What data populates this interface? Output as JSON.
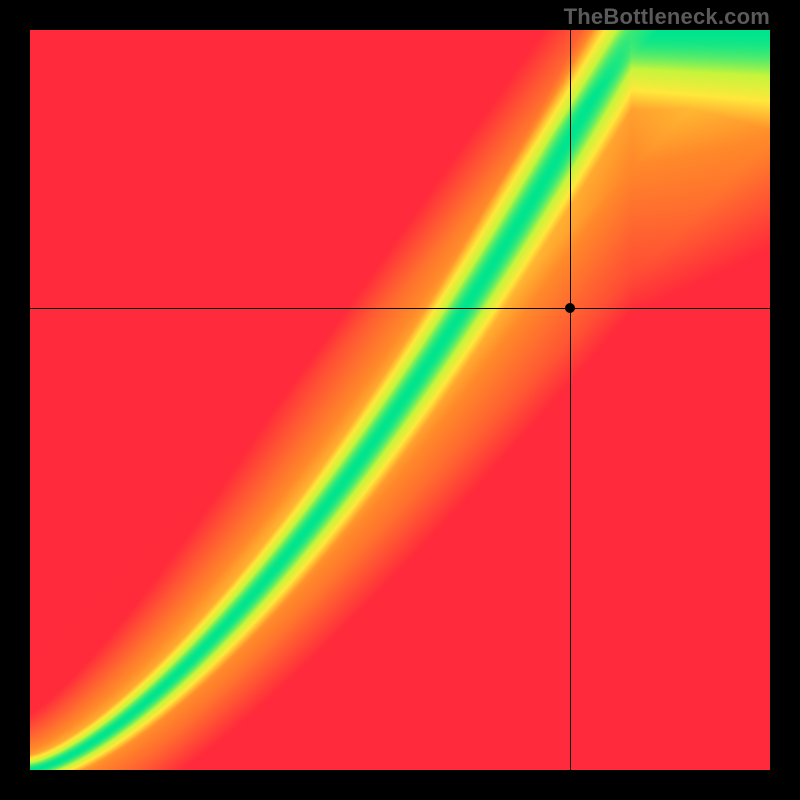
{
  "watermark": "TheBottleneck.com",
  "chart_data": {
    "type": "heatmap",
    "title": "",
    "xlabel": "",
    "ylabel": "",
    "xlim": [
      0,
      100
    ],
    "ylim": [
      0,
      100
    ],
    "grid": false,
    "bands": [
      {
        "function": "6*(x/100)^2 + 0.94*x",
        "band_half_width_start": 2,
        "band_half_width_end": 15
      }
    ],
    "color_scale": [
      {
        "value": 0.0,
        "color": "#ff2a3b"
      },
      {
        "value": 0.45,
        "color": "#ff8a2a"
      },
      {
        "value": 0.68,
        "color": "#ffe83b"
      },
      {
        "value": 0.85,
        "color": "#c8f53b"
      },
      {
        "value": 1.0,
        "color": "#00e58e"
      }
    ],
    "crosshair": {
      "x": 73,
      "y": 62.5
    },
    "marker": {
      "x": 73,
      "y": 62.5
    },
    "notes": "Values are fractions of plot extent (0-100). Heatmap encodes balance: green band = ideal match along the curve, red corners = bottleneck."
  },
  "colors": {
    "background": "#000000",
    "watermark": "#5a5a5a"
  }
}
